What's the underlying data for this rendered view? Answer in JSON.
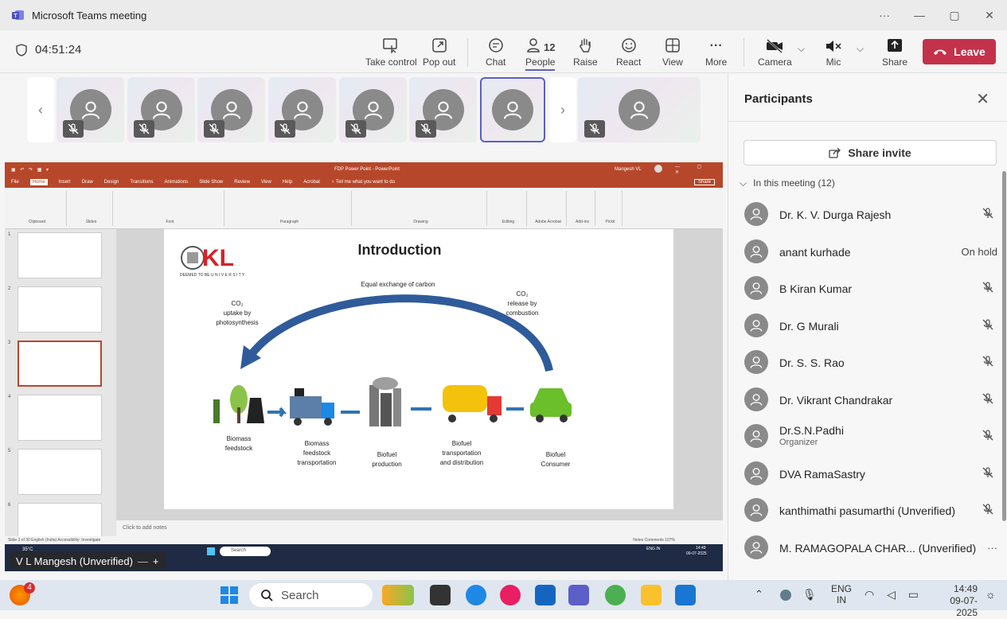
{
  "window": {
    "title": "Microsoft Teams meeting",
    "min": "—",
    "max": "▢",
    "close": "✕",
    "more": "···"
  },
  "toolbar": {
    "timer": "04:51:24",
    "take_control": "Take control",
    "pop_out": "Pop out",
    "chat": "Chat",
    "people": "People",
    "people_count": "12",
    "raise": "Raise",
    "react": "React",
    "view": "View",
    "more": "More",
    "camera": "Camera",
    "mic": "Mic",
    "share": "Share",
    "leave": "Leave"
  },
  "colors": {
    "accent": "#5b5fc7",
    "leave": "#c4314b",
    "ppt": "#b7472a"
  },
  "shared_screen": {
    "ppt_title": "FDP Power Point - PowerPoint",
    "ppt_user": "Mangesh VL",
    "tell_me": "Tell me what you want to do",
    "share_btn": "Share",
    "tabs": [
      "File",
      "Home",
      "Insert",
      "Draw",
      "Design",
      "Transitions",
      "Animations",
      "Slide Show",
      "Review",
      "View",
      "Help",
      "Acrobat"
    ],
    "ribbon_groups": [
      "Clipboard",
      "Slides",
      "Font",
      "Paragraph",
      "Drawing",
      "Editing",
      "Adobe Acrobat",
      "Add-ins",
      "Pickit"
    ],
    "slide_numbers": [
      "1",
      "2",
      "3",
      "4",
      "5",
      "6"
    ],
    "slide": {
      "title": "Introduction",
      "logo_text": "KL",
      "logo_sub": "DEEMED TO BE U N I V E R S I T Y",
      "arc_label": "Equal exchange of carbon",
      "left_label_1": "CO₂",
      "left_label_2": "uptake  by",
      "left_label_3": "photosynthesis",
      "right_label_1": "CO₂",
      "right_label_2": "release by",
      "right_label_3": "combustion",
      "stages": [
        {
          "l1": "Biomass",
          "l2": "feedstock",
          "l3": ""
        },
        {
          "l1": "Biomass",
          "l2": "feedstock",
          "l3": "transportation"
        },
        {
          "l1": "Biofuel",
          "l2": "production",
          "l3": ""
        },
        {
          "l1": "Biofuel",
          "l2": "transportation",
          "l3": "and distribution"
        },
        {
          "l1": "Biofuel",
          "l2": "Consumer",
          "l3": ""
        }
      ]
    },
    "notes": "Click to add notes",
    "status_left": "Slide 3 of 30    English (India)    Accessibility: Investigate",
    "status_right": "Notes   Comments   107%",
    "inner_weather": "35°C",
    "inner_search": "Search",
    "inner_time": "14:49",
    "inner_date": "09-07-2025",
    "inner_lang": "ENG IN"
  },
  "presenter_name": "V L Mangesh (Unverified)",
  "participants": {
    "title": "Participants",
    "share_invite": "Share invite",
    "section": "In this meeting (12)",
    "list": [
      {
        "name": "Dr. K. V. Durga Rajesh",
        "role": "",
        "status": "muted"
      },
      {
        "name": "anant kurhade",
        "role": "",
        "status": "On hold"
      },
      {
        "name": "B Kiran Kumar",
        "role": "",
        "status": "muted"
      },
      {
        "name": "Dr. G Murali",
        "role": "",
        "status": "muted"
      },
      {
        "name": "Dr. S. S. Rao",
        "role": "",
        "status": "muted"
      },
      {
        "name": "Dr. Vikrant Chandrakar",
        "role": "",
        "status": "muted"
      },
      {
        "name": "Dr.S.N.Padhi",
        "role": "Organizer",
        "status": "muted"
      },
      {
        "name": "DVA RamaSastry",
        "role": "",
        "status": "muted"
      },
      {
        "name": "kanthimathi pasumarthi (Unverified)",
        "role": "",
        "status": "muted"
      },
      {
        "name": "M. RAMAGOPALA CHAR... (Unverified)",
        "role": "",
        "status": "···"
      }
    ]
  },
  "taskbar": {
    "search": "Search",
    "notification_count": "4",
    "lang_1": "ENG",
    "lang_2": "IN",
    "time": "14:49",
    "date": "09-07-2025"
  }
}
